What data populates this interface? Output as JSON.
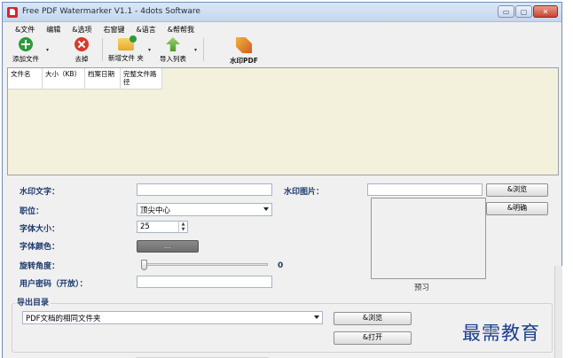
{
  "window": {
    "title": "Free PDF Watermarker V1.1 - 4dots Software",
    "buttons": {
      "minimize": "▭",
      "maximize": "▢",
      "close": "✕"
    }
  },
  "menu": [
    "&文件",
    "编辑",
    "&选项",
    "右窗键",
    "&语言",
    "&帮帮我"
  ],
  "toolbar": {
    "add_files": "添加文件",
    "remove": "去掉",
    "new_folder": "新增文件 夹",
    "import_list": "导入列表",
    "watermark_pdf": "水印PDF",
    "dropdown_arrow": "▾"
  },
  "file_list": {
    "columns": [
      "文件名",
      "大小（KB）",
      "档案日期",
      "完整文件路径"
    ]
  },
  "form": {
    "watermark_text_label": "水印文字：",
    "watermark_text_value": "",
    "watermark_image_label": "水印图片：",
    "watermark_image_value": "",
    "browse_label": "&浏览",
    "clear_label": "&明确",
    "position_label": "职位：",
    "position_value": "顶尖中心",
    "font_size_label": "字体大小：",
    "font_size_value": "25",
    "font_color_label": "字体颜色：",
    "font_color_button": "...",
    "rotation_label": "旋转角度：",
    "rotation_value": "0",
    "user_password_label": "用户密码（开放）：",
    "user_password_value": "",
    "preview_label": "预习",
    "spin_up": "▲",
    "spin_down": "▼"
  },
  "output": {
    "title": "导出目录",
    "folder_value": "PDF文档的相同文件夹",
    "browse_label": "&浏览",
    "open_label": "&打开"
  },
  "overlay_logo": "最需教育",
  "colors": {
    "label_blue": "#1e3a6e",
    "list_bg": "#f3f0dc",
    "window_bg": "#f0f0f0"
  }
}
